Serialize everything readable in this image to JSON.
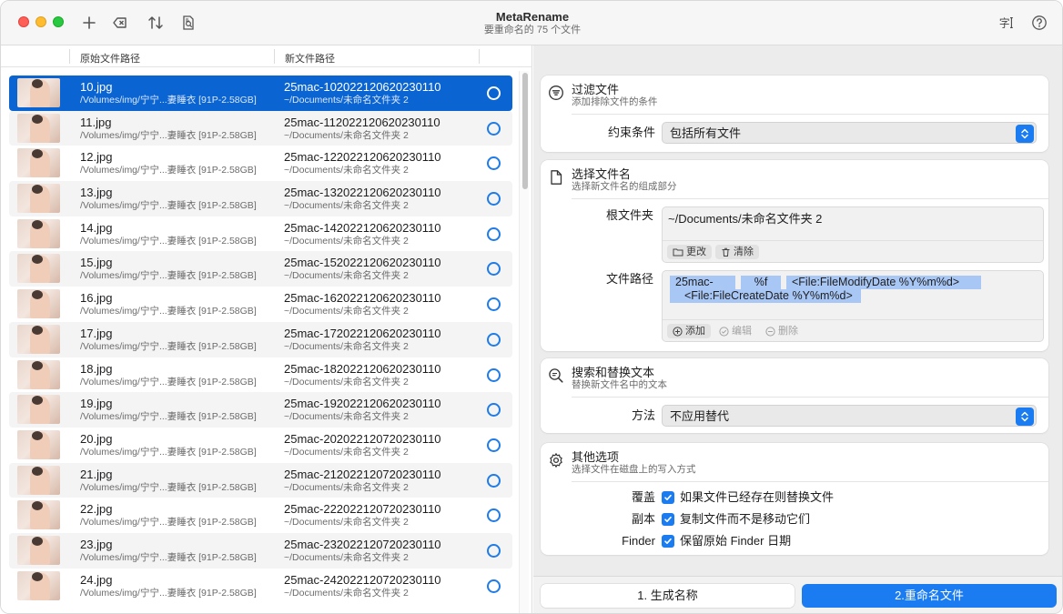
{
  "titlebar": {
    "title": "MetaRename",
    "subtitle": "要重命名的 75 个文件",
    "icons": [
      "plus-icon",
      "delete-key-icon",
      "sort-icon",
      "document-search-icon",
      "text-cursor-icon",
      "help-icon"
    ]
  },
  "list": {
    "col_original": "原始文件路径",
    "col_new": "新文件路径",
    "rows": [
      {
        "name": "10.jpg",
        "path": "/Volumes/img/宁宁...妻睡衣 [91P-2.58GB]",
        "new_name": "25mac-102022120620230110",
        "new_path": "~/Documents/未命名文件夹 2",
        "selected": true
      },
      {
        "name": "11.jpg",
        "path": "/Volumes/img/宁宁...妻睡衣 [91P-2.58GB]",
        "new_name": "25mac-112022120620230110",
        "new_path": "~/Documents/未命名文件夹 2"
      },
      {
        "name": "12.jpg",
        "path": "/Volumes/img/宁宁...妻睡衣 [91P-2.58GB]",
        "new_name": "25mac-122022120620230110",
        "new_path": "~/Documents/未命名文件夹 2"
      },
      {
        "name": "13.jpg",
        "path": "/Volumes/img/宁宁...妻睡衣 [91P-2.58GB]",
        "new_name": "25mac-132022120620230110",
        "new_path": "~/Documents/未命名文件夹 2"
      },
      {
        "name": "14.jpg",
        "path": "/Volumes/img/宁宁...妻睡衣 [91P-2.58GB]",
        "new_name": "25mac-142022120620230110",
        "new_path": "~/Documents/未命名文件夹 2"
      },
      {
        "name": "15.jpg",
        "path": "/Volumes/img/宁宁...妻睡衣 [91P-2.58GB]",
        "new_name": "25mac-152022120620230110",
        "new_path": "~/Documents/未命名文件夹 2"
      },
      {
        "name": "16.jpg",
        "path": "/Volumes/img/宁宁...妻睡衣 [91P-2.58GB]",
        "new_name": "25mac-162022120620230110",
        "new_path": "~/Documents/未命名文件夹 2"
      },
      {
        "name": "17.jpg",
        "path": "/Volumes/img/宁宁...妻睡衣 [91P-2.58GB]",
        "new_name": "25mac-172022120620230110",
        "new_path": "~/Documents/未命名文件夹 2"
      },
      {
        "name": "18.jpg",
        "path": "/Volumes/img/宁宁...妻睡衣 [91P-2.58GB]",
        "new_name": "25mac-182022120620230110",
        "new_path": "~/Documents/未命名文件夹 2"
      },
      {
        "name": "19.jpg",
        "path": "/Volumes/img/宁宁...妻睡衣 [91P-2.58GB]",
        "new_name": "25mac-192022120620230110",
        "new_path": "~/Documents/未命名文件夹 2"
      },
      {
        "name": "20.jpg",
        "path": "/Volumes/img/宁宁...妻睡衣 [91P-2.58GB]",
        "new_name": "25mac-202022120720230110",
        "new_path": "~/Documents/未命名文件夹 2"
      },
      {
        "name": "21.jpg",
        "path": "/Volumes/img/宁宁...妻睡衣 [91P-2.58GB]",
        "new_name": "25mac-212022120720230110",
        "new_path": "~/Documents/未命名文件夹 2"
      },
      {
        "name": "22.jpg",
        "path": "/Volumes/img/宁宁...妻睡衣 [91P-2.58GB]",
        "new_name": "25mac-222022120720230110",
        "new_path": "~/Documents/未命名文件夹 2"
      },
      {
        "name": "23.jpg",
        "path": "/Volumes/img/宁宁...妻睡衣 [91P-2.58GB]",
        "new_name": "25mac-232022120720230110",
        "new_path": "~/Documents/未命名文件夹 2"
      },
      {
        "name": "24.jpg",
        "path": "/Volumes/img/宁宁...妻睡衣 [91P-2.58GB]",
        "new_name": "25mac-242022120720230110",
        "new_path": "~/Documents/未命名文件夹 2"
      }
    ]
  },
  "filter": {
    "title": "过滤文件",
    "subtitle": "添加排除文件的条件",
    "label": "约束条件",
    "value": "包括所有文件"
  },
  "naming": {
    "title": "选择文件名",
    "subtitle": "选择新文件名的组成部分",
    "root_label": "根文件夹",
    "root_value": "~/Documents/未命名文件夹 2",
    "change_label": "更改",
    "clear_label": "清除",
    "path_label": "文件路径",
    "tokens": [
      "25mac-",
      "%f",
      "<File:FileModifyDate %Y%m%d>",
      "<File:FileCreateDate %Y%m%d>"
    ],
    "add_label": "添加",
    "edit_label": "编辑",
    "delete_label": "删除"
  },
  "replace": {
    "title": "搜索和替换文本",
    "subtitle": "替换新文件名中的文本",
    "label": "方法",
    "value": "不应用替代"
  },
  "options": {
    "title": "其他选项",
    "subtitle": "选择文件在磁盘上的写入方式",
    "items": [
      {
        "label": "覆盖",
        "text": "如果文件已经存在则替换文件",
        "checked": true
      },
      {
        "label": "副本",
        "text": "复制文件而不是移动它们",
        "checked": true
      },
      {
        "label": "Finder",
        "text": "保留原始 Finder 日期",
        "checked": true
      }
    ]
  },
  "actions": {
    "generate": "1. 生成名称",
    "rename": "2.重命名文件"
  },
  "colors": {
    "accent": "#1a7cf0",
    "selection": "#0a64d2",
    "token": "#a8c7f5"
  }
}
